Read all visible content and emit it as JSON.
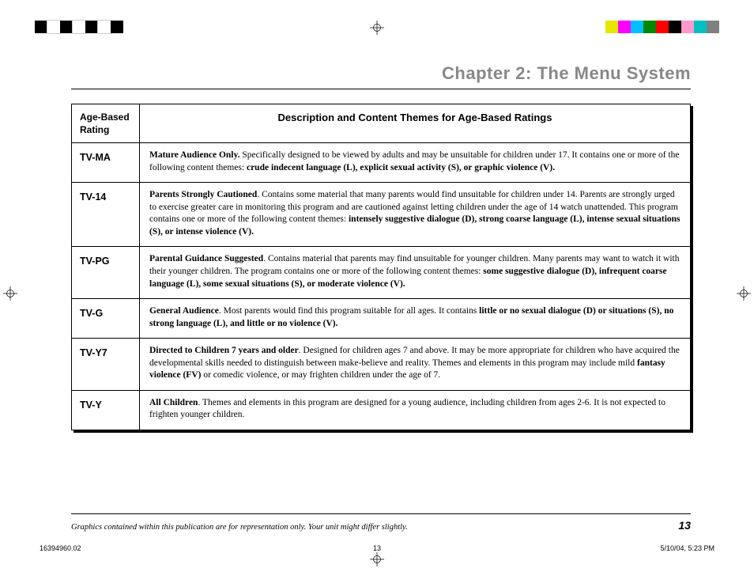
{
  "header": {
    "chapter_title": "Chapter 2: The Menu System"
  },
  "color_bars": {
    "left": [
      "#000000",
      "#ffffff",
      "#000000",
      "#ffffff",
      "#000000",
      "#ffffff",
      "#000000"
    ],
    "right": [
      "#e6e600",
      "#ff00ff",
      "#00bfff",
      "#008800",
      "#ff0000",
      "#000000",
      "#ff99cc",
      "#00c0c0",
      "#808080"
    ]
  },
  "table": {
    "head_label": "Age-Based Rating",
    "head_desc": "Description and Content Themes for Age-Based Ratings",
    "rows": [
      {
        "label": "TV-MA",
        "lead": "Mature Audience Only.",
        "body_a": " Specifically designed to be viewed by adults and may be unsuitable for children under 17.  It contains one or more of the following content themes:  ",
        "bold_b": "crude indecent language (L), explicit sexual activity (S), or graphic violence (V).",
        "body_c": ""
      },
      {
        "label": "TV-14",
        "lead": "Parents Strongly Cautioned",
        "body_a": ". Contains some material that many parents would find unsuitable for children under 14.  Parents are strongly urged to exercise greater care in monitoring this program and are cautioned against letting children under the age of 14 watch unattended.  This program contains one or more of the following content themes:  ",
        "bold_b": "intensely suggestive dialogue (D), strong coarse language (L), intense sexual situations (S), or intense violence (V).",
        "body_c": ""
      },
      {
        "label": "TV-PG",
        "lead": "Parental Guidance Suggested",
        "body_a": ". Contains material that parents may find unsuitable for younger children.  Many parents may want to watch it with their younger children.  The program contains one or more of the following content themes:  ",
        "bold_b": "some suggestive dialogue (D), infrequent coarse language (L), some sexual situations (S), or moderate violence (V).",
        "body_c": ""
      },
      {
        "label": "TV-G",
        "lead": "General Audience",
        "body_a": ". Most parents would find this program suitable for all ages.  It contains ",
        "bold_b": "little or no sexual dialogue (D) or situations (S), no strong language (L), and little or no violence (V).",
        "body_c": ""
      },
      {
        "label": "TV-Y7",
        "lead": "Directed to Children 7 years and older",
        "body_a": ". Designed for children ages 7 and above.  It may be more appropriate for children who have acquired the developmental skills needed to distinguish between make-believe and reality.  Themes and elements in this program may include mild ",
        "bold_b": "fantasy violence (FV)",
        "body_c": " or comedic violence, or may frighten children under the age of 7."
      },
      {
        "label": "TV-Y",
        "lead": "All Children",
        "body_a": ". Themes and elements in this program are designed for a young audience, including children from ages 2-6.  It is not expected to frighten younger children.",
        "bold_b": "",
        "body_c": ""
      }
    ]
  },
  "footer": {
    "note": "Graphics contained within this publication are for representation only. Your unit might differ slightly.",
    "page": "13"
  },
  "crop": {
    "id": "16394960.02",
    "page": "13",
    "stamp": "5/10/04, 5:23 PM"
  }
}
